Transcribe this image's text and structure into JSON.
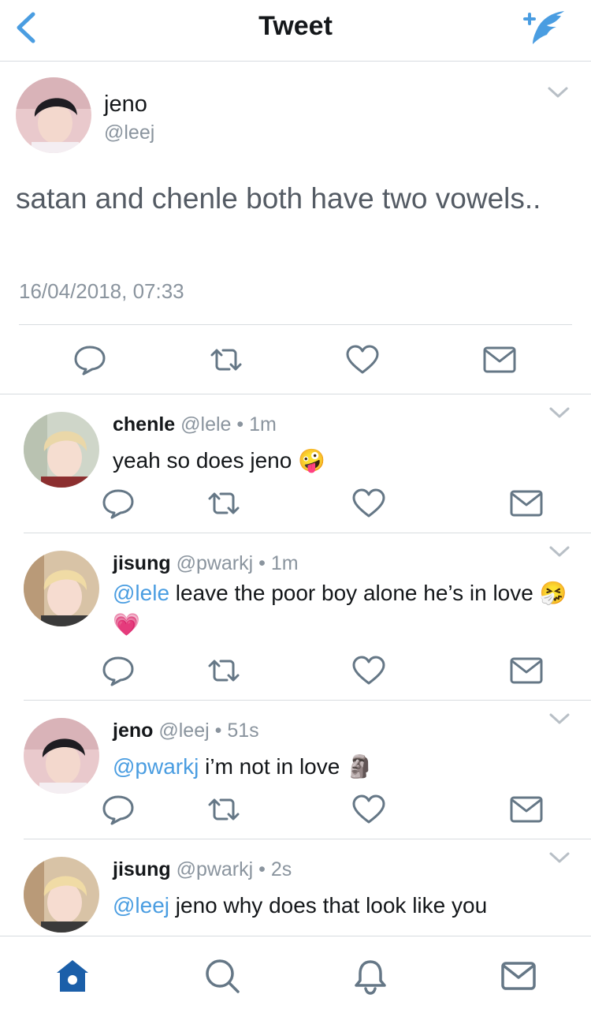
{
  "header": {
    "title": "Tweet",
    "back_icon": "chevron-left-icon",
    "compose_icon": "compose-tweet-icon",
    "accent_color": "#4a9de1"
  },
  "main_tweet": {
    "name": "jeno",
    "handle": "@leej",
    "text": "satan and chenle both have two vowels..",
    "timestamp": "16/04/2018, 07:33",
    "actions": [
      "reply-icon",
      "retweet-icon",
      "like-icon",
      "direct-message-icon"
    ]
  },
  "replies": [
    {
      "name": "chenle",
      "handle": "@lele",
      "time": "1m",
      "mention": "",
      "text": "yeah so does jeno",
      "emoji": "🤪"
    },
    {
      "name": "jisung",
      "handle": "@pwarkj",
      "time": "1m",
      "mention": "@lele",
      "text": " leave the poor boy alone he’s in love",
      "emoji": "🤧💗"
    },
    {
      "name": "jeno",
      "handle": "@leej",
      "time": "51s",
      "mention": "@pwarkj",
      "text": " i’m not in love ",
      "emoji": "🗿"
    },
    {
      "name": "jisung",
      "handle": "@pwarkj",
      "time": "2s",
      "mention": "@leej",
      "text": " jeno why does that look like you",
      "emoji": ""
    }
  ],
  "separator": " • ",
  "tabbar": {
    "items": [
      "home-icon",
      "search-icon",
      "notifications-icon",
      "messages-icon"
    ],
    "active": "home-icon"
  }
}
